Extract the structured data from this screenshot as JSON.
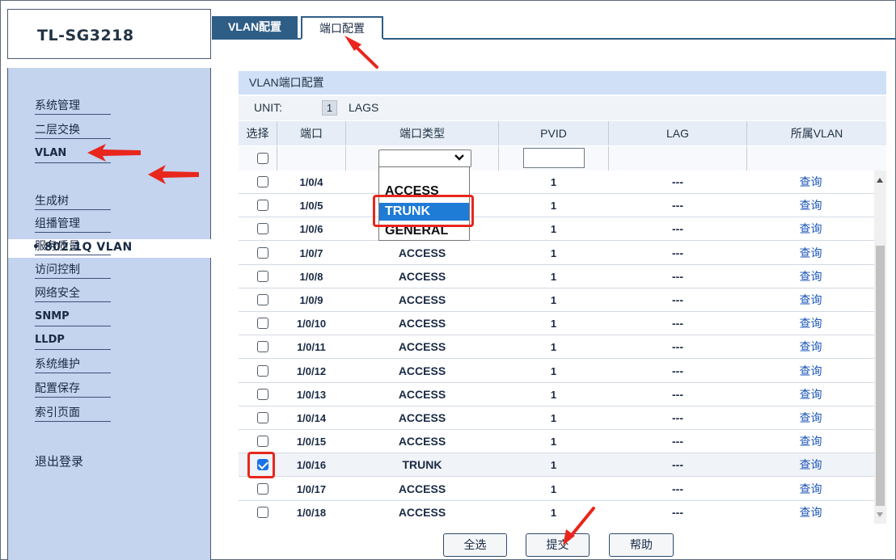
{
  "app": {
    "model": "TL-SG3218"
  },
  "nav": {
    "items": [
      {
        "label": "系统管理",
        "en": false
      },
      {
        "label": "二层交换",
        "en": false
      },
      {
        "label": "VLAN",
        "en": true
      },
      {
        "label": "生成树",
        "en": false
      },
      {
        "label": "组播管理",
        "en": false
      },
      {
        "label": "服务质量",
        "en": false
      },
      {
        "label": "访问控制",
        "en": false
      },
      {
        "label": "网络安全",
        "en": false
      },
      {
        "label": "SNMP",
        "en": true
      },
      {
        "label": "LLDP",
        "en": true
      },
      {
        "label": "系统维护",
        "en": false
      },
      {
        "label": "配置保存",
        "en": false
      },
      {
        "label": "索引页面",
        "en": false
      }
    ],
    "active_sub": "• 802.1Q VLAN",
    "logout": "退出登录"
  },
  "tabs": [
    {
      "label": "VLAN配置",
      "active": false
    },
    {
      "label": "端口配置",
      "active": true
    }
  ],
  "section": {
    "title": "VLAN端口配置",
    "unit_label": "UNIT:",
    "unit_value": "1",
    "lags_label": "LAGS"
  },
  "table": {
    "headers": [
      "选择",
      "端口",
      "端口类型",
      "PVID",
      "LAG",
      "所属VLAN"
    ],
    "rows": [
      {
        "port": "1/0/4",
        "type": "",
        "pvid": "1",
        "lag": "---",
        "query": "查询",
        "checked": false
      },
      {
        "port": "1/0/5",
        "type": "",
        "pvid": "1",
        "lag": "---",
        "query": "查询",
        "checked": false
      },
      {
        "port": "1/0/6",
        "type": "",
        "pvid": "1",
        "lag": "---",
        "query": "查询",
        "checked": false
      },
      {
        "port": "1/0/7",
        "type": "ACCESS",
        "pvid": "1",
        "lag": "---",
        "query": "查询",
        "checked": false
      },
      {
        "port": "1/0/8",
        "type": "ACCESS",
        "pvid": "1",
        "lag": "---",
        "query": "查询",
        "checked": false
      },
      {
        "port": "1/0/9",
        "type": "ACCESS",
        "pvid": "1",
        "lag": "---",
        "query": "查询",
        "checked": false
      },
      {
        "port": "1/0/10",
        "type": "ACCESS",
        "pvid": "1",
        "lag": "---",
        "query": "查询",
        "checked": false
      },
      {
        "port": "1/0/11",
        "type": "ACCESS",
        "pvid": "1",
        "lag": "---",
        "query": "查询",
        "checked": false
      },
      {
        "port": "1/0/12",
        "type": "ACCESS",
        "pvid": "1",
        "lag": "---",
        "query": "查询",
        "checked": false
      },
      {
        "port": "1/0/13",
        "type": "ACCESS",
        "pvid": "1",
        "lag": "---",
        "query": "查询",
        "checked": false
      },
      {
        "port": "1/0/14",
        "type": "ACCESS",
        "pvid": "1",
        "lag": "---",
        "query": "查询",
        "checked": false
      },
      {
        "port": "1/0/15",
        "type": "ACCESS",
        "pvid": "1",
        "lag": "---",
        "query": "查询",
        "checked": false
      },
      {
        "port": "1/0/16",
        "type": "TRUNK",
        "pvid": "1",
        "lag": "---",
        "query": "查询",
        "checked": true
      },
      {
        "port": "1/0/17",
        "type": "ACCESS",
        "pvid": "1",
        "lag": "---",
        "query": "查询",
        "checked": false
      },
      {
        "port": "1/0/18",
        "type": "ACCESS",
        "pvid": "1",
        "lag": "---",
        "query": "查询",
        "checked": false
      }
    ]
  },
  "dropdown": {
    "options": [
      "ACCESS",
      "TRUNK",
      "GENERAL"
    ],
    "selected": "TRUNK"
  },
  "buttons": {
    "select_all": "全选",
    "submit": "提交",
    "help": "帮助"
  },
  "colors": {
    "accent": "#2e5d86",
    "nav_bg": "#c4d3ee",
    "link": "#1a55b8",
    "annotation": "#e8261d",
    "dropdown_highlight": "#1e7bd6"
  }
}
